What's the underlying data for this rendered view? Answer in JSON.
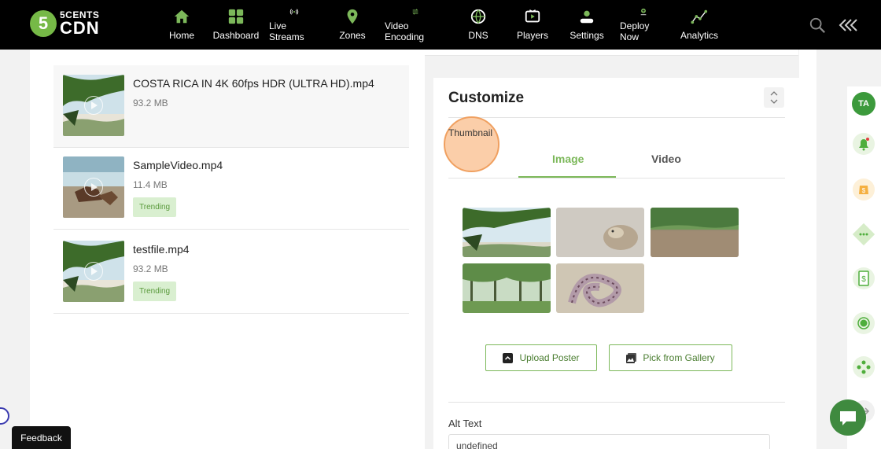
{
  "brand": {
    "logo_number": "5",
    "line1": "5CENTS",
    "line2": "CDN"
  },
  "nav": [
    {
      "label": "Home",
      "icon": "home-icon"
    },
    {
      "label": "Dashboard",
      "icon": "dashboard-icon"
    },
    {
      "label": "Live Streams",
      "icon": "live-streams-icon"
    },
    {
      "label": "Zones",
      "icon": "zones-icon"
    },
    {
      "label": "Video Encoding",
      "icon": "video-encoding-icon"
    },
    {
      "label": "DNS",
      "icon": "dns-icon"
    },
    {
      "label": "Players",
      "icon": "players-icon"
    },
    {
      "label": "Settings",
      "icon": "settings-icon"
    },
    {
      "label": "Deploy Now",
      "icon": "deploy-now-icon"
    },
    {
      "label": "Analytics",
      "icon": "analytics-icon"
    }
  ],
  "videos": [
    {
      "name": "COSTA RICA IN 4K 60fps HDR (ULTRA HD).mp4",
      "size": "93.2 MB",
      "badge": ""
    },
    {
      "name": "SampleVideo.mp4",
      "size": "11.4 MB",
      "badge": "Trending"
    },
    {
      "name": "testfile.mp4",
      "size": "93.2 MB",
      "badge": "Trending"
    }
  ],
  "customize": {
    "title": "Customize",
    "thumbnail_label": "Thumbnail",
    "tabs": [
      {
        "label": "Image",
        "active": true
      },
      {
        "label": "Video",
        "active": false
      }
    ],
    "gallery_images": [
      "palm-beach-thumbnail",
      "snake-closeup-thumbnail",
      "river-thumbnail",
      "palm-forest-thumbnail",
      "coiled-snake-thumbnail"
    ],
    "upload_label": "Upload Poster",
    "gallery_label": "Pick from Gallery",
    "alt_text_label": "Alt Text",
    "alt_text_value": "undefined"
  },
  "user": {
    "initials": "TA"
  },
  "feedback_label": "Feedback",
  "colors": {
    "accent": "#7cb85a",
    "topbar": "#000000",
    "badge_bg": "#d9efd0",
    "avatar": "#3c9a3c"
  }
}
